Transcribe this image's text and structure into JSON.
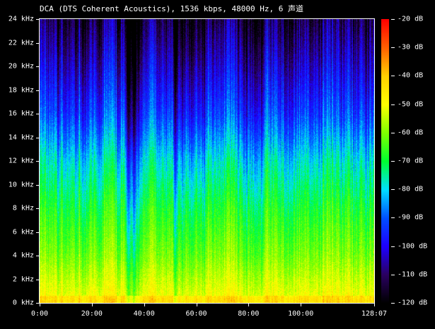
{
  "title": "DCA (DTS Coherent Acoustics), 1536 kbps, 48000 Hz, 6 声道",
  "chart_data": {
    "type": "heatmap",
    "title": "DCA (DTS Coherent Acoustics), 1536 kbps, 48000 Hz, 6 声道",
    "x_ticks": [
      "0:00",
      "20:00",
      "40:00",
      "60:00",
      "80:00",
      "100:00",
      "128:07"
    ],
    "x_tick_minutes": [
      0,
      20,
      40,
      60,
      80,
      100,
      128.117
    ],
    "xlim_minutes": [
      0,
      128.117
    ],
    "y_ticks": [
      "0 kHz",
      "2 kHz",
      "4 kHz",
      "6 kHz",
      "8 kHz",
      "10 kHz",
      "12 kHz",
      "14 kHz",
      "16 kHz",
      "18 kHz",
      "20 kHz",
      "22 kHz",
      "24 kHz"
    ],
    "ylim_khz": [
      0,
      24
    ],
    "colorbar_ticks": [
      "-20 dB",
      "-30 dB",
      "-40 dB",
      "-50 dB",
      "-60 dB",
      "-70 dB",
      "-80 dB",
      "-90 dB",
      "-100 dB",
      "-110 dB",
      "-120 dB"
    ],
    "colorbar_range_db": [
      -120,
      -20
    ],
    "colormap": [
      {
        "db": -120,
        "color": "#000000"
      },
      {
        "db": -110,
        "color": "#2a0060"
      },
      {
        "db": -100,
        "color": "#1e00ff"
      },
      {
        "db": -90,
        "color": "#0050ff"
      },
      {
        "db": -80,
        "color": "#00e0ff"
      },
      {
        "db": -70,
        "color": "#00ff30"
      },
      {
        "db": -60,
        "color": "#80ff00"
      },
      {
        "db": -50,
        "color": "#ffff00"
      },
      {
        "db": -40,
        "color": "#ffd000"
      },
      {
        "db": -30,
        "color": "#ff6000"
      },
      {
        "db": -20,
        "color": "#ff0000"
      }
    ],
    "level_profile_db_by_khz": [
      {
        "khz": 0,
        "db": -48
      },
      {
        "khz": 4,
        "db": -60
      },
      {
        "khz": 8,
        "db": -68
      },
      {
        "khz": 12,
        "db": -78
      },
      {
        "khz": 16,
        "db": -92
      },
      {
        "khz": 20,
        "db": -102
      },
      {
        "khz": 24,
        "db": -112
      }
    ],
    "quiet_sections_minutes": [
      34,
      36,
      52
    ]
  }
}
